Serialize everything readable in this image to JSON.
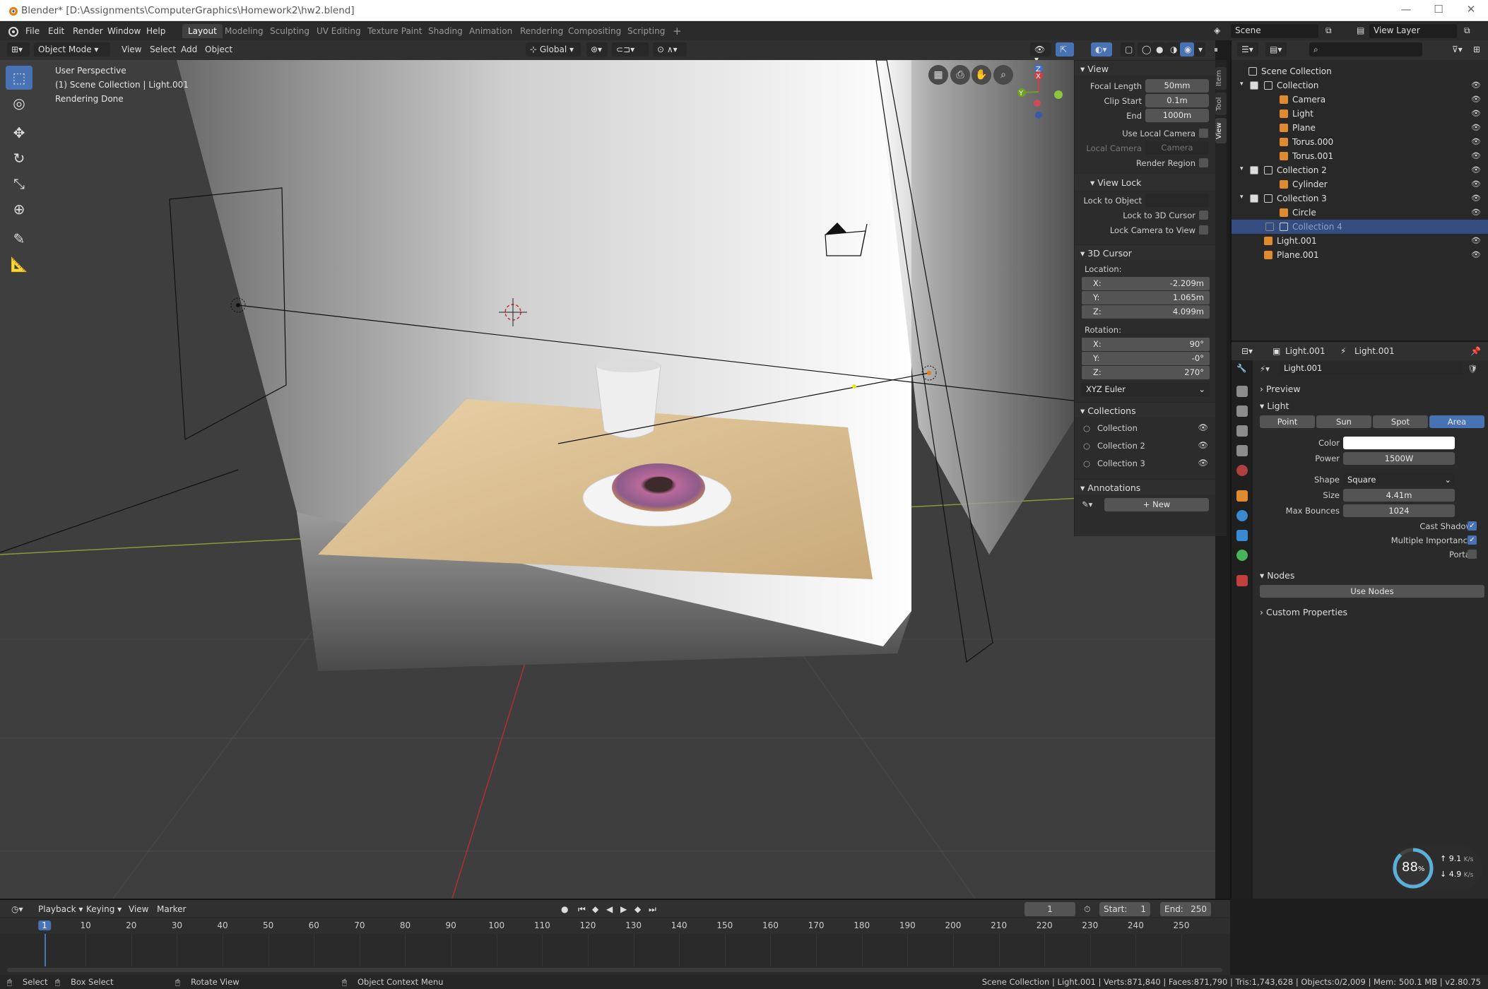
{
  "window": {
    "title": "Blender* [D:\\Assignments\\ComputerGraphics\\Homework2\\hw2.blend]"
  },
  "topbar": {
    "menus": [
      "File",
      "Edit",
      "Render",
      "Window",
      "Help"
    ],
    "workspaces": [
      "Layout",
      "Modeling",
      "Sculpting",
      "UV Editing",
      "Texture Paint",
      "Shading",
      "Animation",
      "Rendering",
      "Compositing",
      "Scripting"
    ],
    "active_workspace": "Layout",
    "scene": "Scene",
    "view_layer": "View Layer"
  },
  "viewport_header": {
    "mode": "Object Mode",
    "menus": [
      "View",
      "Select",
      "Add",
      "Object"
    ],
    "orientation": "Global"
  },
  "viewport": {
    "info": [
      "User Perspective",
      "(1) Scene Collection | Light.001",
      "Rendering Done"
    ],
    "gizmo_axes": [
      "Z",
      "X",
      "Y"
    ]
  },
  "npanel": {
    "tabs": [
      "Item",
      "Tool",
      "View"
    ],
    "view": {
      "header": "View",
      "focal_length_label": "Focal Length",
      "focal_length": "50mm",
      "clip_start_label": "Clip Start",
      "clip_start": "0.1m",
      "end_label": "End",
      "end": "1000m",
      "use_local_camera": "Use Local Camera",
      "local_camera_label": "Local Camera",
      "local_camera": "Camera",
      "render_region": "Render Region"
    },
    "view_lock": {
      "header": "View Lock",
      "lock_to_object": "Lock to Object",
      "lock_to_cursor": "Lock to 3D Cursor",
      "lock_camera": "Lock Camera to View"
    },
    "cursor": {
      "header": "3D Cursor",
      "location_label": "Location:",
      "loc": [
        {
          "axis": "X:",
          "value": "-2.209m"
        },
        {
          "axis": "Y:",
          "value": "1.065m"
        },
        {
          "axis": "Z:",
          "value": "4.099m"
        }
      ],
      "rotation_label": "Rotation:",
      "rot": [
        {
          "axis": "X:",
          "value": "90°"
        },
        {
          "axis": "Y:",
          "value": "-0°"
        },
        {
          "axis": "Z:",
          "value": "270°"
        }
      ],
      "mode": "XYZ Euler"
    },
    "collections": {
      "header": "Collections",
      "items": [
        "Collection",
        "Collection 2",
        "Collection 3"
      ]
    },
    "annotations": {
      "header": "Annotations",
      "new": "New"
    }
  },
  "outliner": {
    "root": "Scene Collection",
    "rows": [
      {
        "name": "Collection",
        "indent": 1
      },
      {
        "name": "Camera",
        "indent": 2
      },
      {
        "name": "Light",
        "indent": 2
      },
      {
        "name": "Plane",
        "indent": 2
      },
      {
        "name": "Torus.000",
        "indent": 2
      },
      {
        "name": "Torus.001",
        "indent": 2
      },
      {
        "name": "Collection 2",
        "indent": 1
      },
      {
        "name": "Cylinder",
        "indent": 2
      },
      {
        "name": "Collection 3",
        "indent": 1
      },
      {
        "name": "Circle",
        "indent": 2
      },
      {
        "name": "Collection 4",
        "indent": 2
      },
      {
        "name": "Light.001",
        "indent": 1
      },
      {
        "name": "Plane.001",
        "indent": 1
      }
    ]
  },
  "properties": {
    "breadcrumb_obj": "Light.001",
    "breadcrumb_data": "Light.001",
    "datablock": "Light.001",
    "preview": "Preview",
    "light_header": "Light",
    "light_types": [
      "Point",
      "Sun",
      "Spot",
      "Area"
    ],
    "active_type": "Area",
    "color_label": "Color",
    "power_label": "Power",
    "power": "1500W",
    "shape_label": "Shape",
    "shape": "Square",
    "size_label": "Size",
    "size": "4.41m",
    "bounces_label": "Max Bounces",
    "bounces": "1024",
    "cast_shadow": "Cast Shadow",
    "multiple_importance": "Multiple Importance",
    "portal": "Portal",
    "nodes_header": "Nodes",
    "use_nodes": "Use Nodes",
    "custom_props": "Custom Properties"
  },
  "timeline": {
    "menus": [
      "Playback",
      "Keying",
      "View",
      "Marker"
    ],
    "current_frame": "1",
    "start_label": "Start:",
    "start": "1",
    "end_label": "End:",
    "end": "250",
    "ticks": [
      "1",
      "10",
      "20",
      "30",
      "40",
      "50",
      "60",
      "70",
      "80",
      "90",
      "100",
      "110",
      "120",
      "130",
      "140",
      "150",
      "160",
      "170",
      "180",
      "190",
      "200",
      "210",
      "220",
      "230",
      "240",
      "250"
    ]
  },
  "gauge": {
    "percent": "88",
    "up": "9.1",
    "down": "4.9",
    "unit": "K/s"
  },
  "statusbar": {
    "select": "Select",
    "box_select": "Box Select",
    "rotate": "Rotate View",
    "context": "Object Context Menu",
    "stats": "Scene Collection | Light.001 | Verts:871,840 | Faces:871,790 | Tris:1,743,628 | Objects:0/2,009 | Mem: 500.1 MB | v2.80.75"
  }
}
